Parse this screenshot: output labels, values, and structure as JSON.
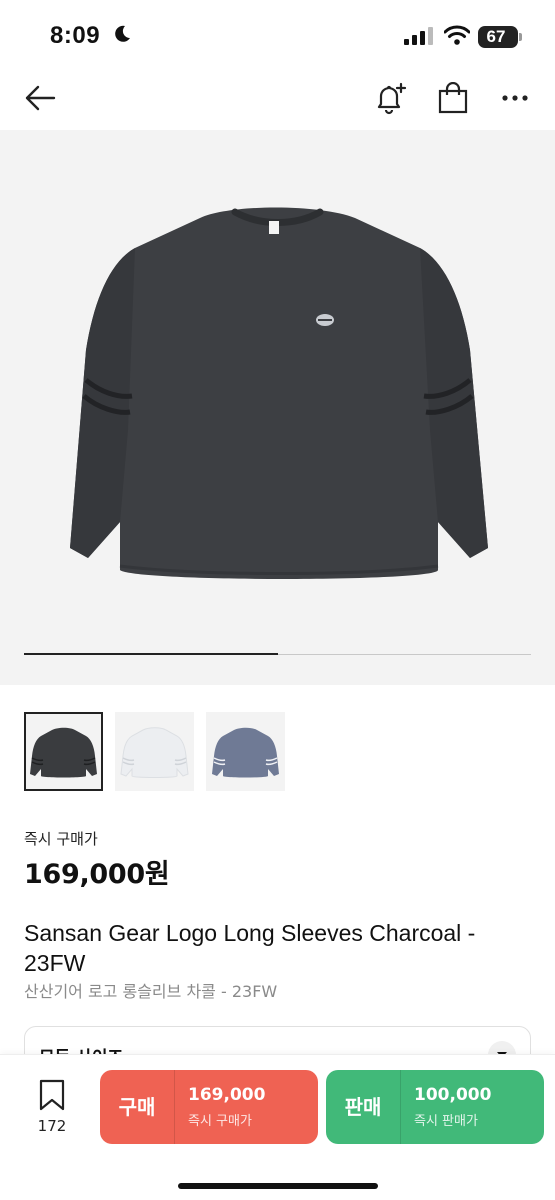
{
  "status_bar": {
    "time": "8:09",
    "battery": "67"
  },
  "product": {
    "price_label": "즉시 구매가",
    "price": "169,000원",
    "name_en": "Sansan Gear Logo Long Sleeves Charcoal - 23FW",
    "name_ko": "산산기어 로고 롱슬리브 차콜 - 23FW",
    "image_progress": 0.5,
    "thumbnails": [
      {
        "color": "charcoal",
        "hex": "#3a3c3f"
      },
      {
        "color": "white",
        "hex": "#eceef1"
      },
      {
        "color": "blue-grey",
        "hex": "#6f7a95"
      }
    ]
  },
  "size_selector": {
    "label": "모든 사이즈"
  },
  "bottom_bar": {
    "bookmark_count": "172",
    "buy": {
      "label": "구매",
      "price": "169,000",
      "sub": "즉시 구매가",
      "color": "#ef6253"
    },
    "sell": {
      "label": "판매",
      "price": "100,000",
      "sub": "즉시 판매가",
      "color": "#41b979"
    }
  }
}
